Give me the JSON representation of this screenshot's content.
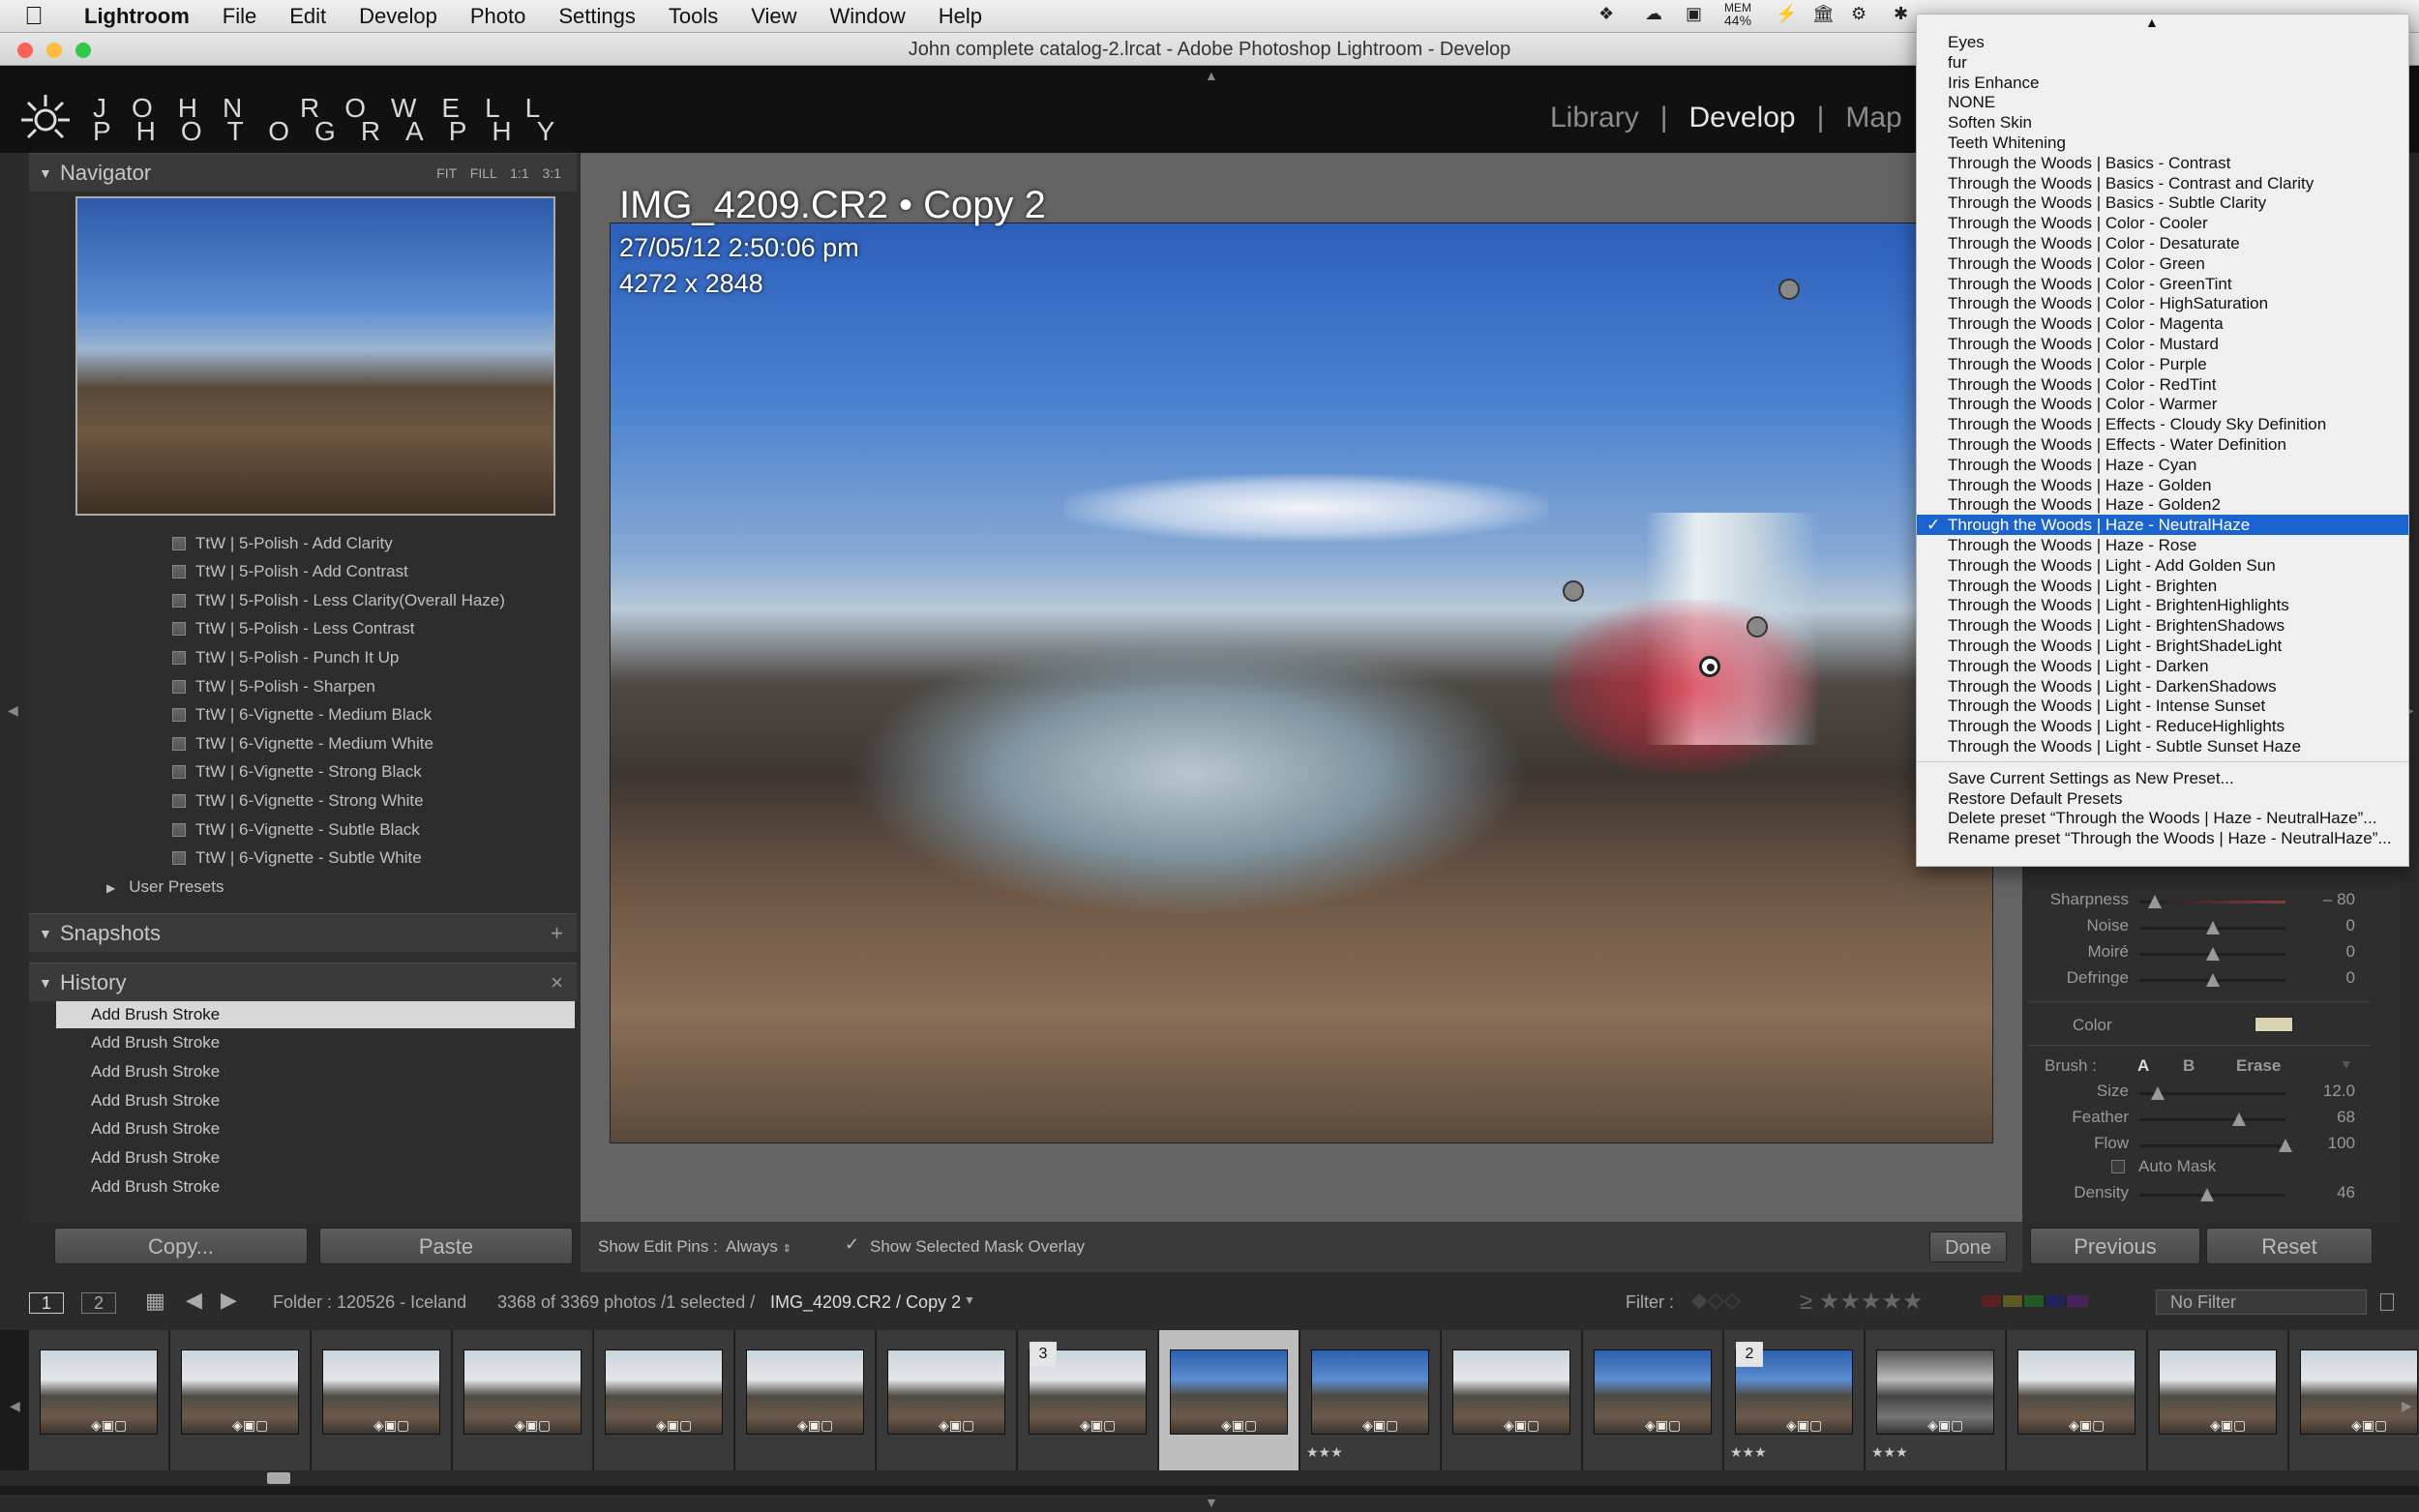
{
  "menubar": {
    "app": "Lightroom",
    "items": [
      "File",
      "Edit",
      "Develop",
      "Photo",
      "Settings",
      "Tools",
      "View",
      "Window",
      "Help"
    ],
    "status_mem": "MEM",
    "status_pct": "44%"
  },
  "window": {
    "title": "John complete catalog-2.lrcat - Adobe Photoshop Lightroom - Develop"
  },
  "identity": {
    "line1": "JOHN ROWELL",
    "line2": "PHOTOGRAPHY"
  },
  "modules": [
    "Library",
    "Develop",
    "Map"
  ],
  "navigator": {
    "title": "Navigator",
    "options": "FIT FILL 1:1 3:1"
  },
  "presets": [
    "TtW | 5-Polish - Add Clarity",
    "TtW | 5-Polish - Add Contrast",
    "TtW | 5-Polish - Less Clarity(Overall Haze)",
    "TtW | 5-Polish - Less Contrast",
    "TtW | 5-Polish - Punch It Up",
    "TtW | 5-Polish - Sharpen",
    "TtW | 6-Vignette - Medium Black",
    "TtW | 6-Vignette - Medium White",
    "TtW | 6-Vignette - Strong Black",
    "TtW | 6-Vignette - Strong White",
    "TtW | 6-Vignette - Subtle Black",
    "TtW | 6-Vignette - Subtle White"
  ],
  "user_presets": "User Presets",
  "snapshots": {
    "title": "Snapshots",
    "action": "+"
  },
  "history": {
    "title": "History",
    "action": "×",
    "items": [
      "Add Brush Stroke",
      "Add Brush Stroke",
      "Add Brush Stroke",
      "Add Brush Stroke",
      "Add Brush Stroke",
      "Add Brush Stroke",
      "Add Brush Stroke"
    ]
  },
  "left_buttons": {
    "copy": "Copy...",
    "paste": "Paste"
  },
  "photo": {
    "name": "IMG_4209.CR2 • Copy 2",
    "date": "27/05/12 2:50:06 pm",
    "dims": "4272 x 2848"
  },
  "toolbar": {
    "pins_label": "Show Edit Pins :",
    "pins_value": "Always",
    "mask_label": "Show Selected Mask Overlay",
    "done": "Done"
  },
  "right_panel": {
    "sliders": [
      {
        "label": "Sharpness",
        "value": "– 80",
        "level": 0.1
      },
      {
        "label": "Noise",
        "value": "0",
        "level": 0.5
      },
      {
        "label": "Moiré",
        "value": "0",
        "level": 0.5
      },
      {
        "label": "Defringe",
        "value": "0",
        "level": 0.5
      }
    ],
    "color_label": "Color",
    "color_swatch": "#d8d3b2",
    "brush_label": "Brush :",
    "brush_a": "A",
    "brush_b": "B",
    "brush_erase": "Erase",
    "brush_sliders": [
      {
        "label": "Size",
        "value": "12.0",
        "level": 0.12
      },
      {
        "label": "Feather",
        "value": "68",
        "level": 0.68
      },
      {
        "label": "Flow",
        "value": "100",
        "level": 1.0
      }
    ],
    "auto_mask": "Auto Mask",
    "density": {
      "label": "Density",
      "value": "46",
      "level": 0.46
    },
    "previous": "Previous",
    "reset": "Reset"
  },
  "filmbar": {
    "page1": "1",
    "page2": "2",
    "folder": "Folder : 120526 - Iceland",
    "count": "3368 of 3369 photos /1 selected /",
    "file": "IMG_4209.CR2 / Copy 2",
    "filter_label": "Filter :",
    "filter_value": "No Filter"
  },
  "filmstrip": [
    {
      "badge": "",
      "stars": "",
      "style": "gray"
    },
    {
      "badge": "",
      "stars": "",
      "style": "gray"
    },
    {
      "badge": "",
      "stars": "",
      "style": "gray"
    },
    {
      "badge": "",
      "stars": "",
      "style": "gray"
    },
    {
      "badge": "",
      "stars": "",
      "style": "gray"
    },
    {
      "badge": "",
      "stars": "",
      "style": "gray"
    },
    {
      "badge": "",
      "stars": "",
      "style": "gray"
    },
    {
      "badge": "3",
      "stars": "",
      "style": "gray"
    },
    {
      "badge": "",
      "stars": "",
      "style": "blue",
      "selected": true
    },
    {
      "badge": "",
      "stars": "★★★",
      "style": "blue"
    },
    {
      "badge": "",
      "stars": "",
      "style": "gray"
    },
    {
      "badge": "",
      "stars": "",
      "style": "blue"
    },
    {
      "badge": "2",
      "stars": "★★★",
      "style": "blue"
    },
    {
      "badge": "",
      "stars": "★★★",
      "style": "bw"
    },
    {
      "badge": "",
      "stars": "",
      "style": "gray"
    },
    {
      "badge": "",
      "stars": "",
      "style": "gray"
    },
    {
      "badge": "",
      "stars": "",
      "style": "gray"
    }
  ],
  "dropdown": {
    "items": [
      "Eyes",
      "fur",
      "Iris Enhance",
      "NONE",
      "Soften Skin",
      "Teeth Whitening",
      "Through the Woods | Basics - Contrast",
      "Through the Woods | Basics - Contrast and Clarity",
      "Through the Woods | Basics - Subtle Clarity",
      "Through the Woods | Color - Cooler",
      "Through the Woods | Color - Desaturate",
      "Through the Woods | Color - Green",
      "Through the Woods | Color - GreenTint",
      "Through the Woods | Color - HighSaturation",
      "Through the Woods | Color - Magenta",
      "Through the Woods | Color - Mustard",
      "Through the Woods | Color - Purple",
      "Through the Woods | Color - RedTint",
      "Through the Woods | Color - Warmer",
      "Through the Woods | Effects - Cloudy Sky Definition",
      "Through the Woods | Effects - Water Definition",
      "Through the Woods | Haze - Cyan",
      "Through the Woods | Haze - Golden",
      "Through the Woods | Haze - Golden2",
      "Through the Woods | Haze - NeutralHaze",
      "Through the Woods | Haze - Rose",
      "Through the Woods | Light - Add Golden Sun",
      "Through the Woods | Light - Brighten",
      "Through the Woods | Light - BrightenHighlights",
      "Through the Woods | Light - BrightenShadows",
      "Through the Woods | Light - BrightShadeLight",
      "Through the Woods | Light - Darken",
      "Through the Woods | Light - DarkenShadows",
      "Through the Woods | Light - Intense Sunset",
      "Through the Woods | Light - ReduceHighlights",
      "Through the Woods | Light - Subtle Sunset Haze"
    ],
    "selected_index": 24,
    "check": "✓",
    "actions": [
      "Save Current Settings as New Preset...",
      "Restore Default Presets",
      "Delete preset “Through the Woods | Haze - NeutralHaze”...",
      "Rename preset “Through the Woods | Haze - NeutralHaze”..."
    ]
  }
}
